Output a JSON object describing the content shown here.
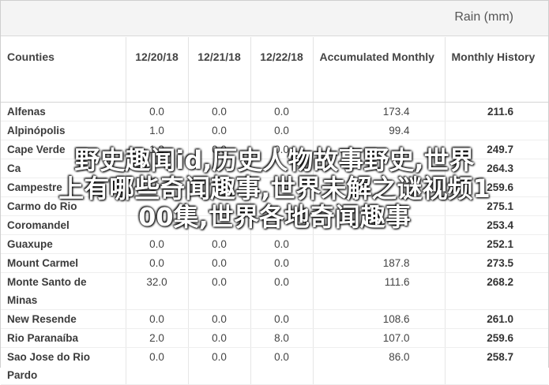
{
  "header": {
    "unit_label": "Rain (mm)"
  },
  "table": {
    "columns": [
      "Counties",
      "12/20/18",
      "12/21/18",
      "12/22/18",
      "Accumulated Monthly",
      "Monthly History"
    ],
    "rows": [
      [
        "Alfenas",
        "0.0",
        "0.0",
        "0.0",
        "173.4",
        "211.6"
      ],
      [
        "Alpinópolis",
        "1.0",
        "0.0",
        "0.0",
        "99.4",
        ""
      ],
      [
        "Cape Verde",
        "1.2",
        "0.0",
        "0.0",
        "",
        "249.7"
      ],
      [
        "Ca",
        "",
        "",
        "",
        "",
        "264.3"
      ],
      [
        "Campestre",
        "",
        "",
        "",
        "",
        "259.6"
      ],
      [
        "Carmo do Rio",
        "",
        "",
        "",
        "",
        "275.1"
      ],
      [
        "Coromandel",
        "",
        "",
        "",
        "",
        "253.4"
      ],
      [
        "Guaxupe",
        "0.0",
        "0.0",
        "0.0",
        "",
        "252.1"
      ],
      [
        "Mount Carmel",
        "0.0",
        "0.0",
        "0.0",
        "187.8",
        "273.5"
      ],
      [
        "Monte Santo de Minas",
        "32.0",
        "0.0",
        "0.0",
        "111.6",
        "268.2"
      ],
      [
        "New Resende",
        "0.0",
        "0.0",
        "0.0",
        "108.6",
        "261.0"
      ],
      [
        "Rio Paranaíba",
        "2.0",
        "0.0",
        "8.0",
        "107.0",
        "259.6"
      ],
      [
        "Sao Jose do Rio Pardo",
        "0.0",
        "0.0",
        "0.0",
        "86.0",
        "258.7"
      ]
    ]
  },
  "overlay_text": {
    "line1": "野史趣闻id,历史人物故事野史,世界",
    "line2": "上有哪些奇闻趣事,世界未解之谜视频1",
    "line3": "00集,世界各地奇闻趣事"
  }
}
